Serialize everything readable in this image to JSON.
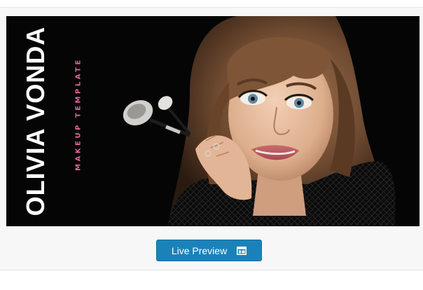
{
  "banner": {
    "title": "OLIVIA VONDA",
    "subtitle": "MAKEUP TEMPLATE",
    "colors": {
      "background": "#050505",
      "title": "#ffffff",
      "subtitle": "#e0649b",
      "hair": "#7a5235",
      "skin": "#e9c0a2"
    }
  },
  "preview_button": {
    "label": "Live Preview",
    "icon": "layout-icon",
    "color": "#1b82b9"
  }
}
